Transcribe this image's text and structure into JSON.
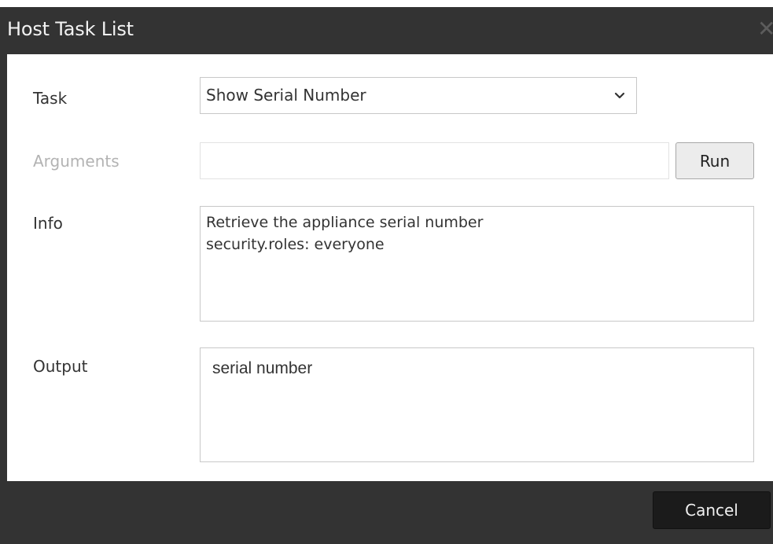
{
  "dialog": {
    "title": "Host Task List",
    "close_icon": "close-icon"
  },
  "form": {
    "task_label": "Task",
    "task_selected": "Show Serial Number",
    "arguments_label": "Arguments",
    "arguments_value": "",
    "run_label": "Run",
    "info_label": "Info",
    "info_lines": [
      "Retrieve the appliance serial number",
      "security.roles: everyone"
    ],
    "output_label": "Output",
    "output_value": "serial number"
  },
  "footer": {
    "cancel_label": "Cancel"
  },
  "colors": {
    "titlebar": "#333333",
    "text": "#333333",
    "disabled_text": "#b3b3b3",
    "button_dark": "#1b1b1b"
  }
}
